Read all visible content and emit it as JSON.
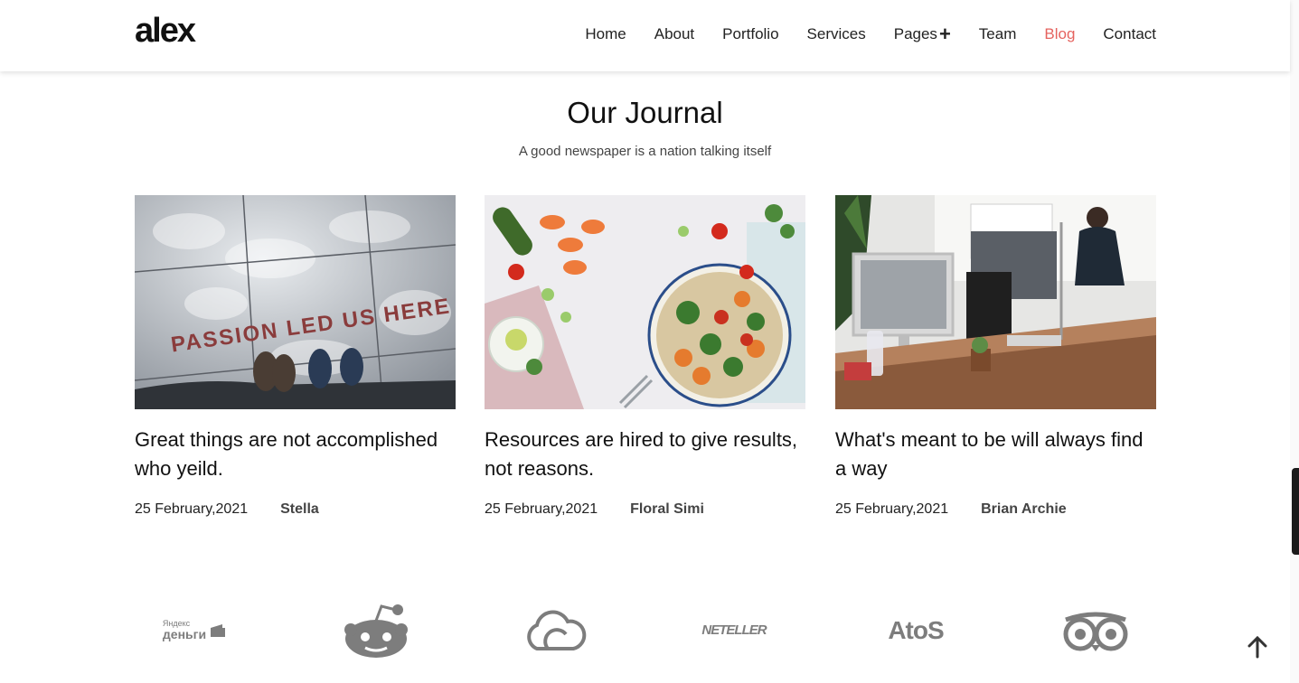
{
  "header": {
    "logo": "alex",
    "nav": [
      {
        "label": "Home"
      },
      {
        "label": "About"
      },
      {
        "label": "Portfolio"
      },
      {
        "label": "Services"
      },
      {
        "label": "Pages"
      },
      {
        "label": "Team"
      },
      {
        "label": "Blog"
      },
      {
        "label": "Contact"
      }
    ]
  },
  "journal": {
    "title": "Our Journal",
    "subtitle": "A good newspaper is a nation talking itself",
    "posts": [
      {
        "title": "Great things are not accomplished who yeild.",
        "date": "25 February,2021",
        "author": "Stella",
        "image_text": "PASSION LED US HERE"
      },
      {
        "title": "Resources are hired to give results, not reasons.",
        "date": "25 February,2021",
        "author": "Floral Simi"
      },
      {
        "title": "What's meant to be will always find a way",
        "date": "25 February,2021",
        "author": "Brian Archie"
      }
    ]
  },
  "brands": [
    {
      "name": "yandex-money-logo",
      "text_top": "Яндекс",
      "text_bottom": "деньги"
    },
    {
      "name": "reddit-logo"
    },
    {
      "name": "cloud-logo"
    },
    {
      "name": "neteller-logo",
      "text": "NETELLER"
    },
    {
      "name": "atos-logo",
      "text": "AtoS"
    },
    {
      "name": "tripadvisor-logo"
    }
  ],
  "colors": {
    "accent": "#e5635f",
    "brand_gray": "#7d7d7d"
  }
}
